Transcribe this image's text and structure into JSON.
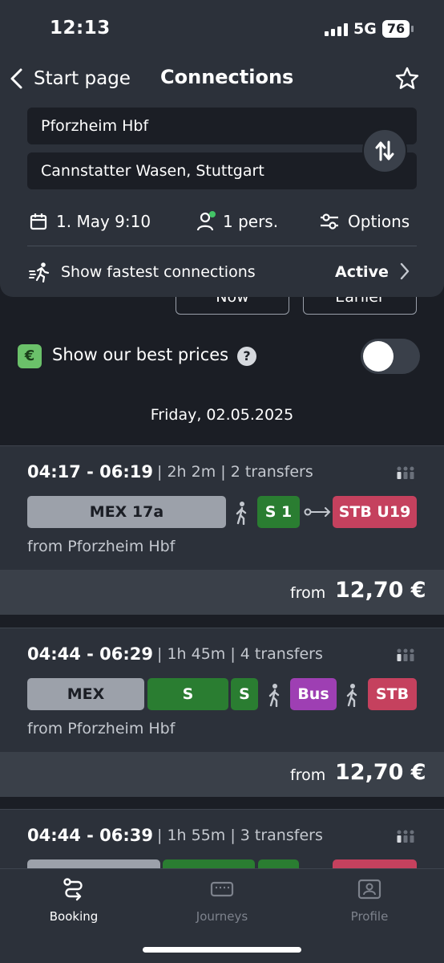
{
  "status_bar": {
    "time": "12:13",
    "network": "5G",
    "battery": "76"
  },
  "header": {
    "back_label": "Start page",
    "title": "Connections",
    "from_station": "Pforzheim Hbf",
    "to_station": "Cannstatter Wasen, Stuttgart",
    "date_time": "1. May 9:10",
    "passengers": "1 pers.",
    "options_label": "Options",
    "fastest_label": "Show fastest connections",
    "fastest_value": "Active"
  },
  "time_buttons": {
    "now": "Now",
    "earlier": "Earlier"
  },
  "best_prices": {
    "label": "Show our best prices",
    "badge": "€",
    "help": "?",
    "enabled": false
  },
  "date_header": "Friday, 02.05.2025",
  "connections": [
    {
      "times": "04:17 - 06:19",
      "meta": "| 2h 2m | 2 transfers",
      "segments": [
        "MEX 17a",
        "S 1",
        "STB U19"
      ],
      "from": "from Pforzheim Hbf",
      "price_prefix": "from",
      "price": "12,70 €"
    },
    {
      "times": "04:44 - 06:29",
      "meta": "| 1h 45m | 4 transfers",
      "segments": [
        "MEX",
        "S",
        "S",
        "Bus",
        "STB"
      ],
      "from": "from Pforzheim Hbf",
      "price_prefix": "from",
      "price": "12,70 €"
    },
    {
      "times": "04:44 - 06:39",
      "meta": "| 1h 55m | 3 transfers"
    }
  ],
  "tabs": {
    "booking": "Booking",
    "journeys": "Journeys",
    "profile": "Profile"
  },
  "colors": {
    "background": "#1b1e25",
    "surface": "#2c313a",
    "regional": "#9ca1aa",
    "sbahn": "#2a7d31",
    "stadtbahn": "#c5415e",
    "bus": "#9e3fb3",
    "accent_green": "#6bc16a"
  }
}
